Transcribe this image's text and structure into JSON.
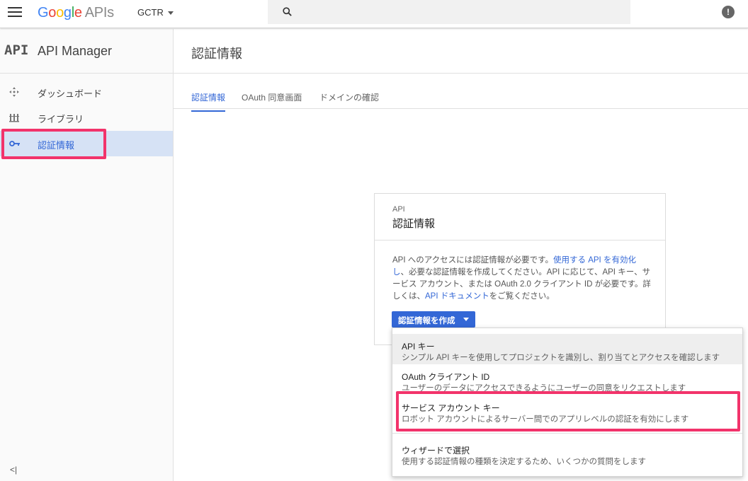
{
  "topbar": {
    "logo_google": [
      "G",
      "o",
      "o",
      "g",
      "l",
      "e"
    ],
    "logo_apis": "APIs",
    "project": "GCTR"
  },
  "sidebar": {
    "logo": "API",
    "title": "API Manager",
    "items": [
      {
        "label": "ダッシュボード",
        "icon": "move-icon"
      },
      {
        "label": "ライブラリ",
        "icon": "library-icon"
      },
      {
        "label": "認証情報",
        "icon": "key-icon",
        "active": true
      }
    ],
    "collapse": "<|"
  },
  "main": {
    "page_title": "認証情報",
    "tabs": [
      {
        "label": "認証情報",
        "active": true
      },
      {
        "label": "OAuth 同意画面"
      },
      {
        "label": "ドメインの確認"
      }
    ]
  },
  "card": {
    "subtitle": "API",
    "title": "認証情報",
    "body_1": "API へのアクセスには認証情報が必要です。",
    "link_1": "使用する API を有効化し",
    "body_2": "、必要な認証情報を作成してください。API に応じて、API キー、サービス アカウント、または OAuth 2.0 クライアント ID が必要です。詳しくは、",
    "link_2": "API ドキュメント",
    "body_3": "をご覧ください。",
    "button": "認証情報を作成"
  },
  "dropdown": {
    "items": [
      {
        "title": "API キー",
        "desc": "シンプル API キーを使用してプロジェクトを識別し、割り当てとアクセスを確認します"
      },
      {
        "title": "OAuth クライアント ID",
        "desc": "ユーザーのデータにアクセスできるようにユーザーの同意をリクエストします"
      },
      {
        "title": "サービス アカウント キー",
        "desc": "ロボット アカウントによるサーバー間でのアプリレベルの認証を有効にします"
      },
      {
        "title": "ウィザードで選択",
        "desc": "使用する認証情報の種類を決定するため、いくつかの質問をします"
      }
    ]
  },
  "colors": {
    "accent": "#3367d6",
    "highlight": "#f2336b"
  }
}
